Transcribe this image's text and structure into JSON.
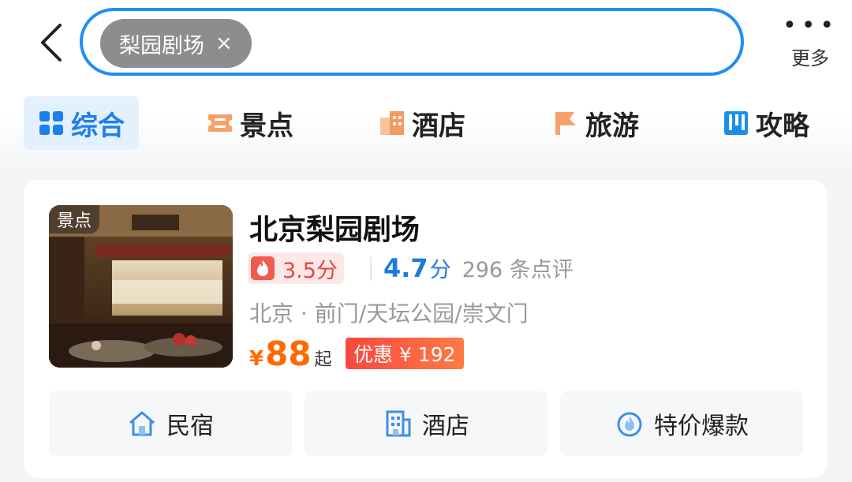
{
  "header": {
    "search_chip": "梨园剧场",
    "chip_close": "×",
    "more_dots": "•••",
    "more_label": "更多"
  },
  "tabs": [
    {
      "label": "综合",
      "icon": "grid-icon",
      "active": true
    },
    {
      "label": "景点",
      "icon": "ticket-icon",
      "active": false
    },
    {
      "label": "酒店",
      "icon": "hotel-building-icon",
      "active": false
    },
    {
      "label": "旅游",
      "icon": "flag-icon",
      "active": false
    },
    {
      "label": "攻略",
      "icon": "guide-book-icon",
      "active": false
    }
  ],
  "result": {
    "tag": "景点",
    "title": "北京梨园剧场",
    "heat_score": "3.5分",
    "rating": "4.7",
    "rating_unit": "分",
    "reviews": "296 条点评",
    "location": "北京 · 前门/天坛公园/崇文门",
    "price_currency": "¥",
    "price": "88",
    "price_suffix": "起",
    "promo": "优惠 ¥ 192"
  },
  "quick_links": [
    {
      "label": "民宿",
      "icon": "house-icon"
    },
    {
      "label": "酒店",
      "icon": "hotel-icon"
    },
    {
      "label": "特价爆款",
      "icon": "fire-deal-icon"
    }
  ],
  "colors": {
    "accent": "#1e8ef7",
    "price": "#ff6a00",
    "promo": "#f7483d",
    "heat": "#e8453c"
  }
}
